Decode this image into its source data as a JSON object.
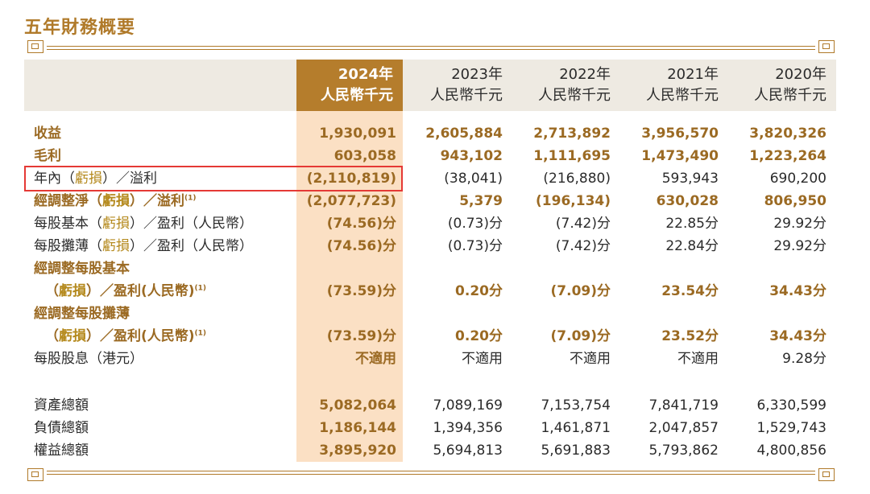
{
  "title": "五年財務概要",
  "headers": [
    {
      "year": "2024年",
      "unit": "人民幣千元"
    },
    {
      "year": "2023年",
      "unit": "人民幣千元"
    },
    {
      "year": "2022年",
      "unit": "人民幣千元"
    },
    {
      "year": "2021年",
      "unit": "人民幣千元"
    },
    {
      "year": "2020年",
      "unit": "人民幣千元"
    }
  ],
  "rows": [
    {
      "label": "收益",
      "values": [
        "1,930,091",
        "2,605,884",
        "2,713,892",
        "3,956,570",
        "3,820,326"
      ]
    },
    {
      "label": "毛利",
      "values": [
        "603,058",
        "943,102",
        "1,111,695",
        "1,473,490",
        "1,223,264"
      ]
    },
    {
      "label_pre": "年內（",
      "label_hl": "虧損",
      "label_post": "）／溢利",
      "values": [
        "(2,110,819)",
        "(38,041)",
        "(216,880)",
        "593,943",
        "690,200"
      ]
    },
    {
      "label_pre": "經調整淨（",
      "label_hl": "虧損",
      "label_post": "）／溢利",
      "note": "(1)",
      "values": [
        "(2,077,723)",
        "5,379",
        "(196,134)",
        "630,028",
        "806,950"
      ]
    },
    {
      "label_pre": "每股基本（",
      "label_hl": "虧損",
      "label_post": "）／盈利（人民幣）",
      "values": [
        "(74.56)分",
        "(0.73)分",
        "(7.42)分",
        "22.85分",
        "29.92分"
      ]
    },
    {
      "label_pre": "每股攤薄（",
      "label_hl": "虧損",
      "label_post": "）／盈利（人民幣）",
      "values": [
        "(74.56)分",
        "(0.73)分",
        "(7.42)分",
        "22.84分",
        "29.92分"
      ]
    },
    {
      "label": "經調整每股基本"
    },
    {
      "label_pre": "（",
      "label_hl": "虧損",
      "label_post": "）／盈利(人民幣)",
      "note": "(1)",
      "values": [
        "(73.59)分",
        "0.20分",
        "(7.09)分",
        "23.54分",
        "34.43分"
      ]
    },
    {
      "label": "經調整每股攤薄"
    },
    {
      "label_pre": "（",
      "label_hl": "虧損",
      "label_post": "）／盈利(人民幣)",
      "note": "(1)",
      "values": [
        "(73.59)分",
        "0.20分",
        "(7.09)分",
        "23.52分",
        "34.43分"
      ]
    },
    {
      "label": "每股股息（港元）",
      "values": [
        "不適用",
        "不適用",
        "不適用",
        "不適用",
        "9.28分"
      ]
    },
    {
      "label": "資產總額",
      "values": [
        "5,082,064",
        "7,089,169",
        "7,153,754",
        "7,841,719",
        "6,330,599"
      ]
    },
    {
      "label": "負債總額",
      "values": [
        "1,186,144",
        "1,394,356",
        "1,461,871",
        "2,047,857",
        "1,529,743"
      ]
    },
    {
      "label": "權益總額",
      "values": [
        "3,895,920",
        "5,694,813",
        "5,691,883",
        "5,793,862",
        "4,800,856"
      ]
    }
  ],
  "colors": {
    "gold": "#b07a2a",
    "highlight_column": "#fbe0c4",
    "header_band": "#eeeae2",
    "selection_box": "#e53935"
  }
}
